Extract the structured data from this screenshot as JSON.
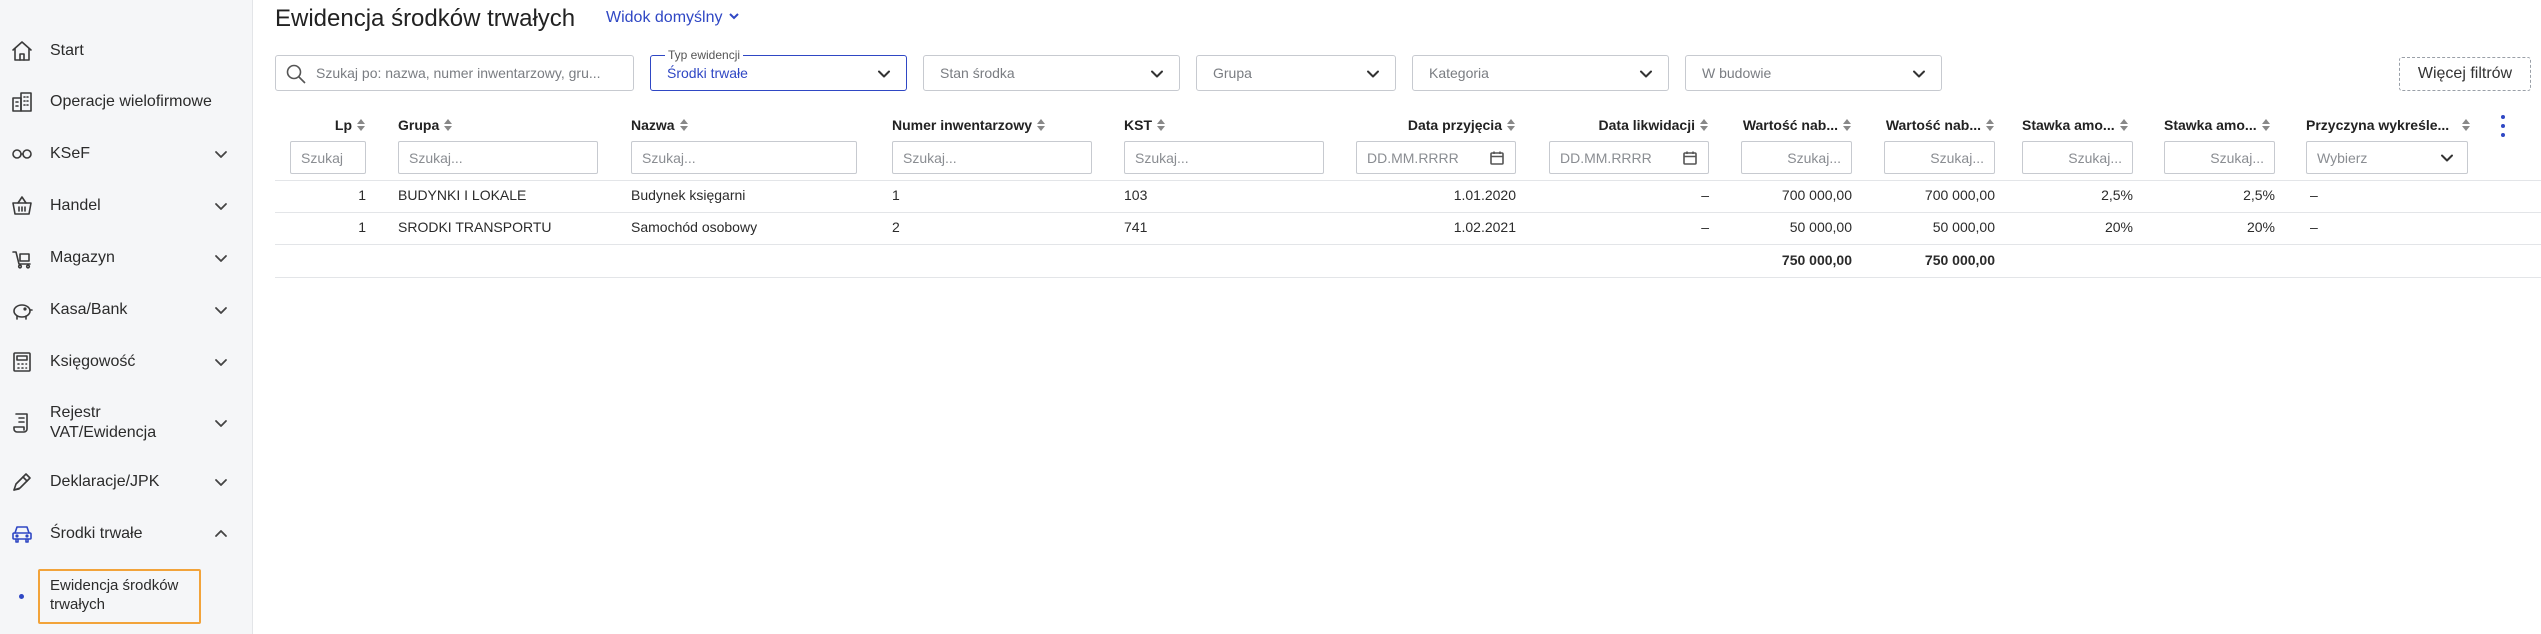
{
  "sidebar": {
    "items": [
      {
        "label": "Start",
        "icon": "home-icon"
      },
      {
        "label": "Operacje wielofirmowe",
        "icon": "companies-icon"
      },
      {
        "label": "KSeF",
        "icon": "ksef-icon"
      },
      {
        "label": "Handel",
        "icon": "basket-icon"
      },
      {
        "label": "Magazyn",
        "icon": "warehouse-icon"
      },
      {
        "label": "Kasa/Bank",
        "icon": "piggy-bank-icon"
      },
      {
        "label": "Księgowość",
        "icon": "calculator-icon"
      },
      {
        "label_line1": "Rejestr",
        "label_line2": "VAT/Ewidencja",
        "icon": "register-icon"
      },
      {
        "label": "Deklaracje/JPK",
        "icon": "pen-icon"
      },
      {
        "label": "Środki trwałe",
        "icon": "car-icon"
      }
    ],
    "subitem": {
      "line1": "Ewidencja środków",
      "line2": "trwałych"
    }
  },
  "header": {
    "title": "Ewidencja środków trwałych",
    "view": "Widok domyślny"
  },
  "filters": {
    "search_placeholder": "Szukaj po: nazwa, numer inwentarzowy, gru...",
    "typ_legend": "Typ ewidencji",
    "typ_value": "Środki trwałe",
    "stan": "Stan środka",
    "grupa": "Grupa",
    "kategoria": "Kategoria",
    "w_budowie": "W budowie",
    "more": "Więcej filtrów"
  },
  "table": {
    "columns": {
      "lp": "Lp",
      "grupa": "Grupa",
      "nazwa": "Nazwa",
      "numer": "Numer inwentarzowy",
      "kst": "KST",
      "data_przyjecia": "Data przyjęcia",
      "data_likwidacji": "Data likwidacji",
      "wartosc1": "Wartość nab...",
      "wartosc2": "Wartość nab...",
      "stawka1": "Stawka amo...",
      "stawka2": "Stawka amo...",
      "przyczyna": "Przyczyna wykreśle..."
    },
    "col_filters": {
      "lp": "Szukaj",
      "text": "Szukaj...",
      "date": "DD.MM.RRRR",
      "select": "Wybierz"
    },
    "rows": [
      {
        "lp": "1",
        "grupa": "BUDYNKI I LOKALE",
        "nazwa": "Budynek księgarni",
        "numer": "1",
        "kst": "103",
        "data_przyjecia": "1.01.2020",
        "data_likwidacji": "–",
        "wartosc1": "700 000,00",
        "wartosc2": "700 000,00",
        "stawka1": "2,5%",
        "stawka2": "2,5%",
        "przyczyna": "–"
      },
      {
        "lp": "1",
        "grupa": "SRODKI TRANSPORTU",
        "nazwa": "Samochód osobowy",
        "numer": "2",
        "kst": "741",
        "data_przyjecia": "1.02.2021",
        "data_likwidacji": "–",
        "wartosc1": "50 000,00",
        "wartosc2": "50 000,00",
        "stawka1": "20%",
        "stawka2": "20%",
        "przyczyna": "–"
      }
    ],
    "totals": {
      "wartosc1": "750 000,00",
      "wartosc2": "750 000,00"
    }
  },
  "colors": {
    "accent": "#2f47c4",
    "highlight": "#f2a33a"
  }
}
